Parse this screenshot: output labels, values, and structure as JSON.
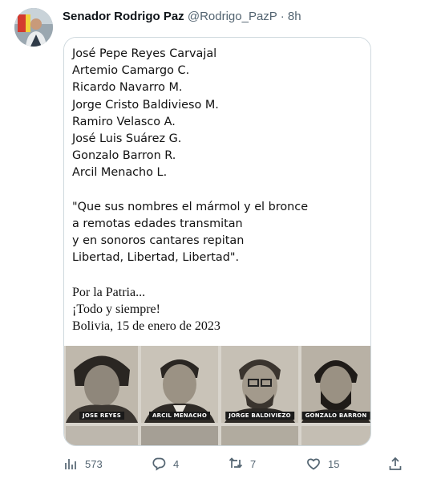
{
  "tweet": {
    "author_name": "Senador Rodrigo Paz",
    "author_handle": "@Rodrigo_PazP",
    "separator": "·",
    "time": "8h"
  },
  "image_text": {
    "names": [
      "José Pepe Reyes Carvajal",
      "Artemio Camargo C.",
      "Ricardo Navarro M.",
      "Jorge Cristo Baldivieso M.",
      "Ramiro Velasco A.",
      "José Luis Suárez G.",
      "Gonzalo Barron R.",
      "Arcil Menacho L."
    ],
    "quote": [
      "\"Que sus nombres el mármol y el bronce",
      "a remotas edades transmitan",
      "y en sonoros cantares repitan",
      "Libertad, Libertad, Libertad\"."
    ],
    "closing": [
      "Por la Patria...",
      "¡Todo y siempre!",
      "Bolivia, 15 de enero de 2023"
    ],
    "photo_labels": [
      "JOSE REYES",
      "ARCIL MENACHO",
      "JORGE BALDIVIEZO",
      "GONZALO BARRON"
    ]
  },
  "actions": {
    "views": "573",
    "replies": "4",
    "retweets": "7",
    "likes": "15",
    "icons": [
      "analytics-icon",
      "reply-icon",
      "retweet-icon",
      "like-icon",
      "share-icon"
    ]
  }
}
